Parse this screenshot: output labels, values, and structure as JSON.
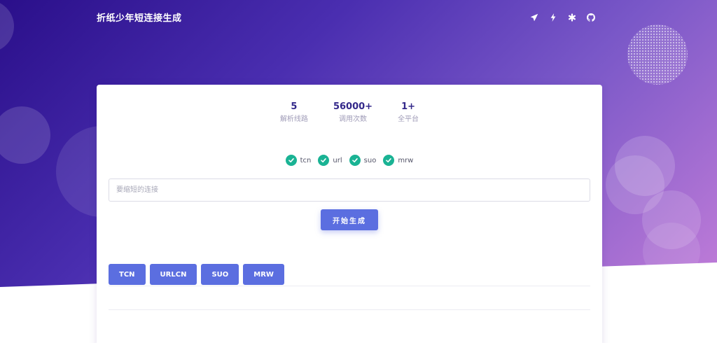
{
  "header": {
    "title": "折纸少年短连接生成",
    "icons": [
      "paper-plane-icon",
      "bolt-icon",
      "asterisk-icon",
      "github-icon"
    ]
  },
  "stats": [
    {
      "value": "5",
      "label": "解析线路"
    },
    {
      "value": "56000+",
      "label": "调用次数"
    },
    {
      "value": "1+",
      "label": "全平台"
    }
  ],
  "services": [
    {
      "label": "tcn"
    },
    {
      "label": "url"
    },
    {
      "label": "suo"
    },
    {
      "label": "mrw"
    }
  ],
  "form": {
    "placeholder": "要缩短的连接",
    "value": "",
    "generate_label": "开始生成"
  },
  "tabs": [
    {
      "label": "TCN"
    },
    {
      "label": "URLCN"
    },
    {
      "label": "SUO"
    },
    {
      "label": "MRW"
    }
  ],
  "colors": {
    "accent": "#5b6ee0",
    "check": "#1ab394",
    "stat_value": "#33288a"
  }
}
